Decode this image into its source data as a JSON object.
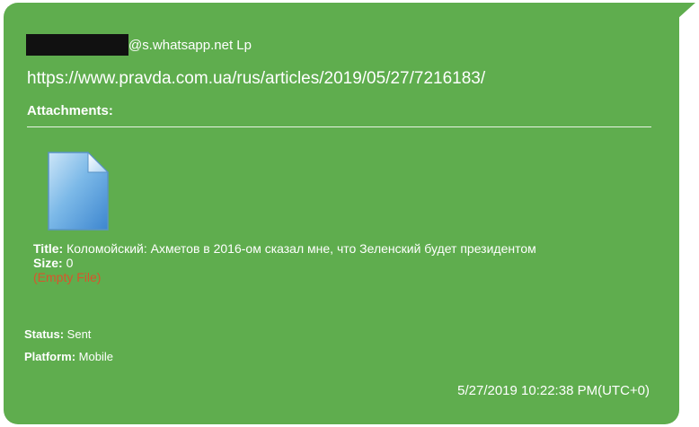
{
  "message": {
    "sender_suffix": "@s.whatsapp.net Lp",
    "url": "https://www.pravda.com.ua/rus/articles/2019/05/27/7216183/",
    "attachments_label": "Attachments:",
    "attachment": {
      "icon": "document-file-icon",
      "title_label": "Title:",
      "title_value": " Коломойский: Ахметов в 2016-ом сказал мне, что Зеленский будет президентом",
      "size_label": "Size:",
      "size_value": " 0",
      "empty_file": "(Empty File)"
    },
    "status_label": "Status:",
    "status_value": " Sent",
    "platform_label": "Platform:",
    "platform_value": " Mobile",
    "timestamp": "5/27/2019 10:22:38 PM(UTC+0)"
  },
  "colors": {
    "bubble": "#5fad4e",
    "text": "#ffffff",
    "empty_file": "#d9542c",
    "redaction": "#111111"
  }
}
